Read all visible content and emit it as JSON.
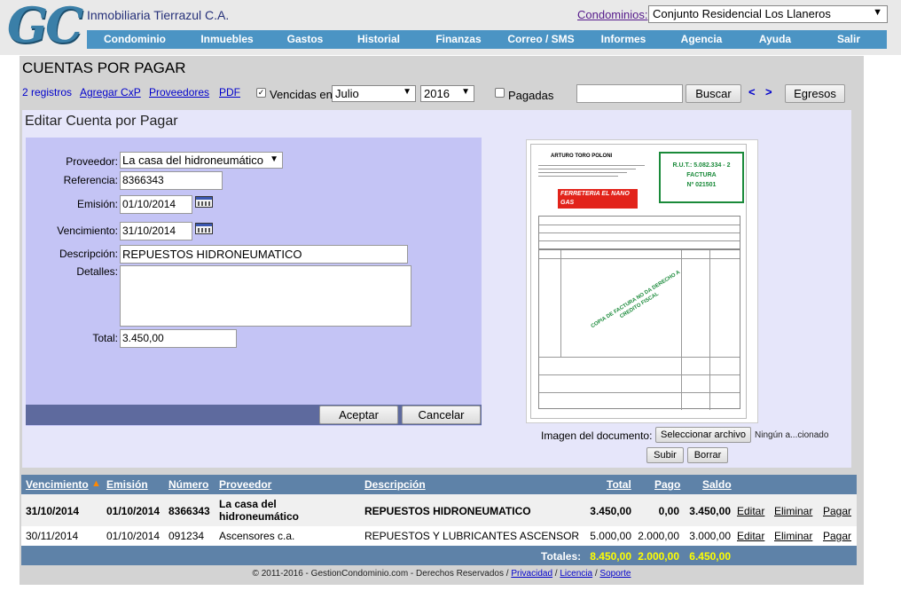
{
  "header": {
    "logo": "GC",
    "company": "Inmobiliaria Tierrazul C.A.",
    "condo_label": "Condominios:",
    "condo_selected": "Conjunto Residencial Los Llaneros",
    "nav": [
      "Condominio",
      "Inmuebles",
      "Gastos",
      "Historial",
      "Finanzas",
      "Correo / SMS",
      "Informes",
      "Agencia",
      "Ayuda",
      "Salir"
    ]
  },
  "page": {
    "title": "CUENTAS POR PAGAR"
  },
  "toolbar": {
    "count": "2 registros",
    "add": "Agregar CxP",
    "providers": "Proveedores",
    "pdf": "PDF",
    "overdue_label": "Vencidas en",
    "overdue_checked": true,
    "month": "Julio",
    "year": "2016",
    "paid_label": "Pagadas",
    "paid_checked": false,
    "search_value": "",
    "search_btn": "Buscar",
    "prev": "<",
    "next": ">",
    "expenses_btn": "Egresos"
  },
  "edit": {
    "title": "Editar Cuenta por Pagar",
    "provider_label": "Proveedor:",
    "provider_value": "La casa del hidroneumático",
    "reference_label": "Referencia:",
    "reference_value": "8366343",
    "issue_label": "Emisión:",
    "issue_value": "01/10/2014",
    "due_label": "Vencimiento:",
    "due_value": "31/10/2014",
    "description_label": "Descripción:",
    "description_value": "REPUESTOS HIDRONEUMATICO",
    "details_label": "Detalles:",
    "details_value": "",
    "total_label": "Total:",
    "total_value": "3.450,00",
    "accept_btn": "Aceptar",
    "cancel_btn": "Cancelar"
  },
  "document": {
    "label": "Imagen del documento:",
    "file_btn": "Seleccionar archivo",
    "no_file": "Ningún a...cionado",
    "upload_btn": "Subir",
    "clear_btn": "Borrar",
    "doc_issuer": "ARTURO TORO POLONI",
    "doc_rut": "R.U.T.: 5.082.334 - 2",
    "doc_type": "FACTURA",
    "doc_number": "Nº 021501",
    "doc_brand": "FERRETERIA EL NANO GAS",
    "doc_stamp": "COPIA DE FACTURA NO DA DERECHO A CREDITO FISCAL"
  },
  "table": {
    "headers": {
      "due": "Vencimiento",
      "issue": "Emisión",
      "number": "Número",
      "provider": "Proveedor",
      "description": "Descripción",
      "total": "Total",
      "paid": "Pago",
      "balance": "Saldo"
    },
    "rows": [
      {
        "due": "31/10/2014",
        "issue": "01/10/2014",
        "number": "8366343",
        "provider1": "La casa del",
        "provider2": "hidroneumático",
        "description": "REPUESTOS HIDRONEUMATICO",
        "total": "3.450,00",
        "paid": "0,00",
        "balance": "3.450,00",
        "edit": "Editar",
        "delete": "Eliminar",
        "pay": "Pagar"
      },
      {
        "due": "30/11/2014",
        "issue": "01/10/2014",
        "number": "091234",
        "provider1": "Ascensores c.a.",
        "provider2": "",
        "description": "REPUESTOS Y LUBRICANTES ASCENSOR",
        "total": "5.000,00",
        "paid": "2.000,00",
        "balance": "3.000,00",
        "edit": "Editar",
        "delete": "Eliminar",
        "pay": "Pagar"
      }
    ],
    "totals_label": "Totales:",
    "totals_total": "8.450,00",
    "totals_paid": "2.000,00",
    "totals_balance": "6.450,00"
  },
  "footer": {
    "copyright": "© 2011-2016 - GestionCondominio.com - Derechos Reservados /",
    "privacy": "Privacidad",
    "license": "Licencia",
    "support": "Soporte"
  }
}
